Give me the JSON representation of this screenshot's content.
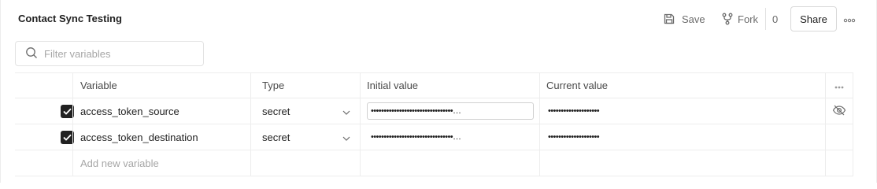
{
  "header": {
    "title": "Contact Sync Testing",
    "save_label": "Save",
    "fork_label": "Fork",
    "fork_count": "0",
    "share_label": "Share"
  },
  "search": {
    "placeholder": "Filter variables"
  },
  "table": {
    "columns": {
      "variable": "Variable",
      "type": "Type",
      "initial": "Initial value",
      "current": "Current value"
    },
    "rows": [
      {
        "checked": true,
        "variable": "access_token_source",
        "type": "secret",
        "initial_value": "••••••••••••••••••••••••••••••••…",
        "current_value": "••••••••••••••••••••"
      },
      {
        "checked": true,
        "variable": "access_token_destination",
        "type": "secret",
        "initial_value": "••••••••••••••••••••••••••••••••…",
        "current_value": "••••••••••••••••••••"
      }
    ],
    "add_placeholder": "Add new variable"
  },
  "colors": {
    "border": "#ededed",
    "text": "#212121",
    "muted": "#6b6b6b",
    "placeholder": "#a6a6a6",
    "checkbox": "#212121"
  },
  "icons": {
    "save": "save-icon",
    "fork": "fork-icon",
    "more": "more-horizontal-icon",
    "search": "search-icon",
    "check": "checkmark-icon",
    "chevron": "chevron-down-icon",
    "eye": "eye-off-icon"
  }
}
